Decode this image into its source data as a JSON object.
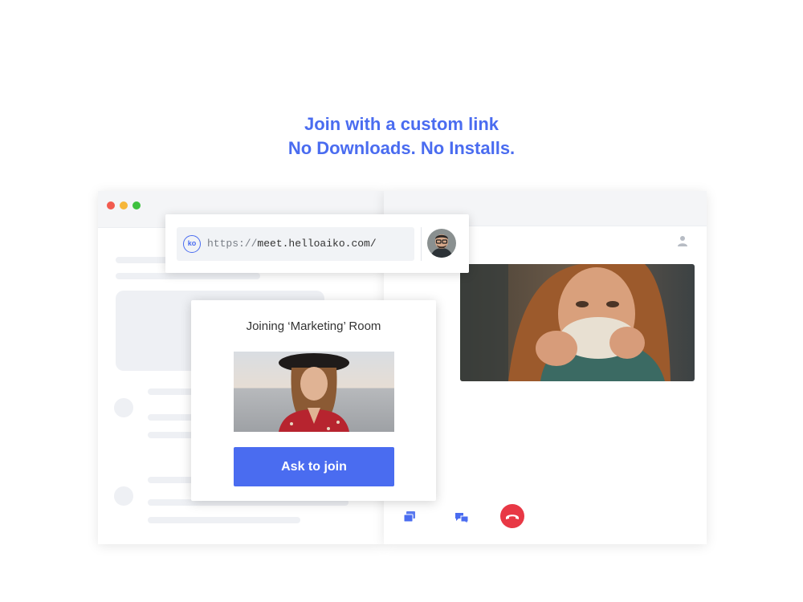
{
  "headline": {
    "line1": "Join with a custom link",
    "line2": "No Downloads. No Installs."
  },
  "address_bar": {
    "logo_text": "ko",
    "url_protocol": "https://",
    "url_host": "meet.helloaiko.com/"
  },
  "join_dialog": {
    "title": "Joining ‘Marketing’ Room",
    "button_label": "Ask to join"
  },
  "icons": {
    "window_controls": [
      "close-dot-icon",
      "minimize-dot-icon",
      "maximize-dot-icon"
    ],
    "participant": "person-icon",
    "screen_share": "screen-share-icon",
    "chat": "chat-icon",
    "hang_up": "hang-up-icon"
  },
  "colors": {
    "accent": "#4a6cf0",
    "hang_up": "#e83845",
    "close_dot": "#f25b4f",
    "minimize_dot": "#f6b73a",
    "maximize_dot": "#3ec13f"
  }
}
